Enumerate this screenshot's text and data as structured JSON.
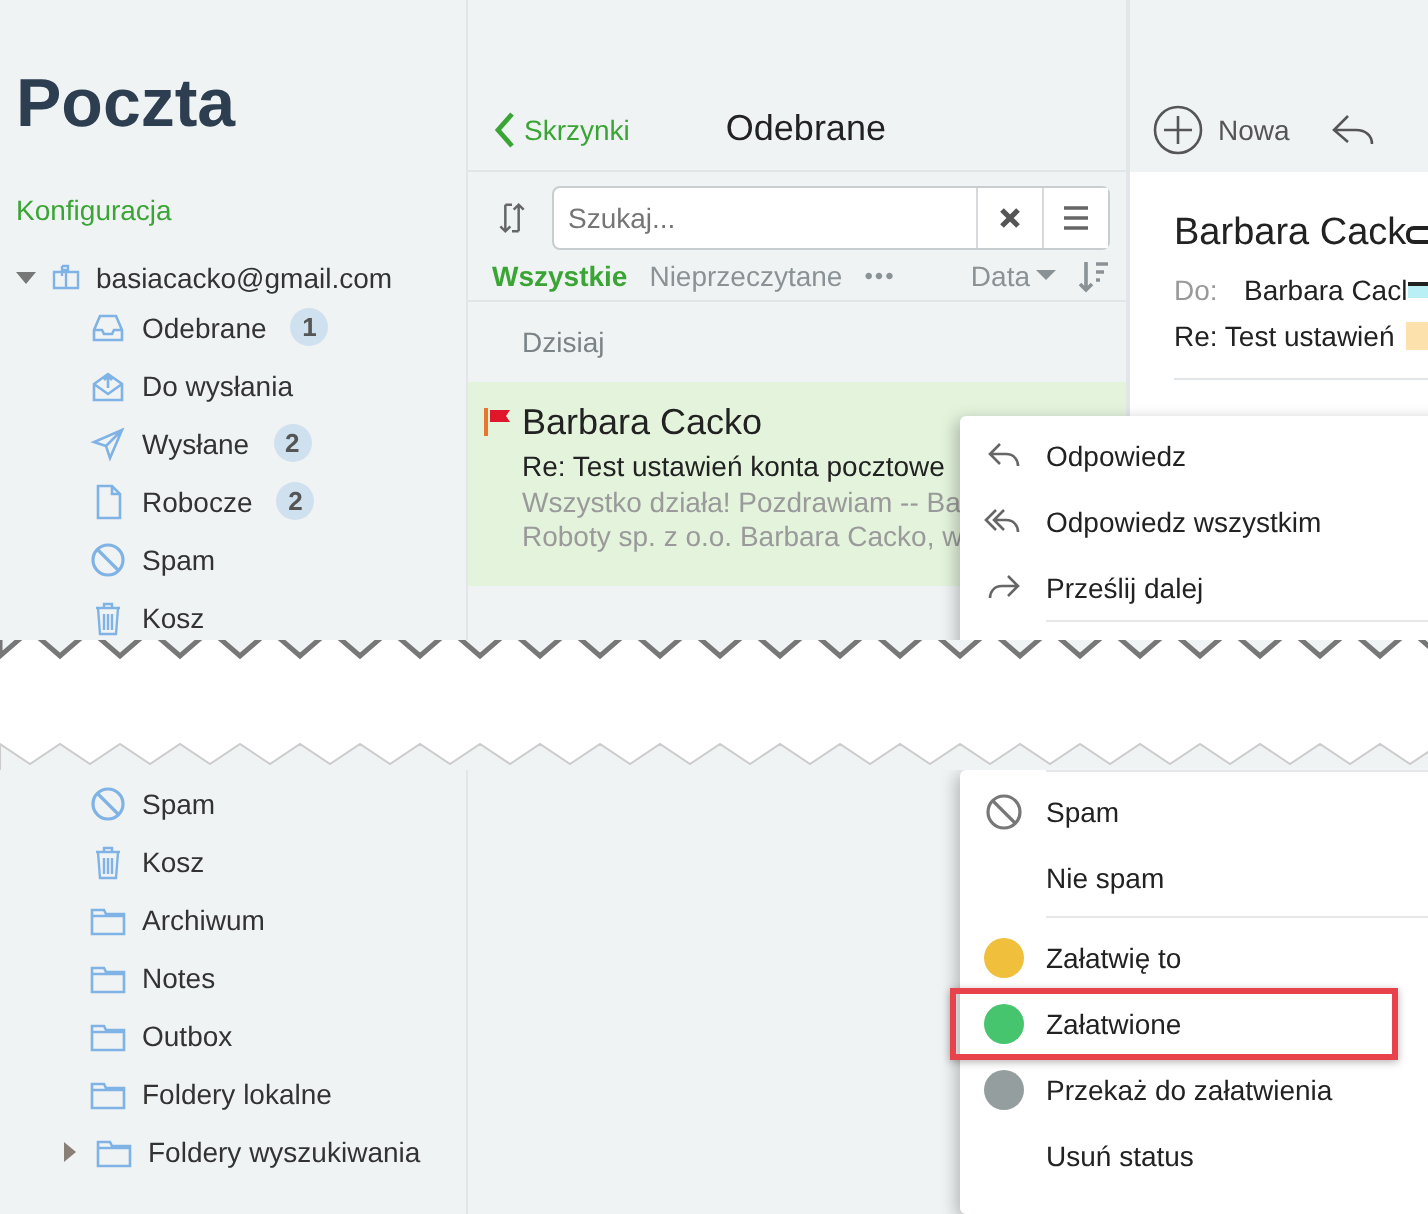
{
  "sidebar": {
    "title": "Poczta",
    "config_link": "Konfiguracja",
    "account": {
      "name": "basiacacko@gmail.com",
      "expanded": true
    },
    "folders_top": [
      {
        "name": "Odebrane",
        "kind": "inbox",
        "badge": "1"
      },
      {
        "name": "Do wysłania",
        "kind": "outbox"
      },
      {
        "name": "Wysłane",
        "kind": "sent",
        "badge": "2"
      },
      {
        "name": "Robocze",
        "kind": "draft",
        "badge": "2"
      },
      {
        "name": "Spam",
        "kind": "spam"
      },
      {
        "name": "Kosz",
        "kind": "trash"
      }
    ],
    "folders_bottom": [
      {
        "name": "Spam",
        "kind": "spam"
      },
      {
        "name": "Kosz",
        "kind": "trash"
      },
      {
        "name": "Archiwum",
        "kind": "folder"
      },
      {
        "name": "Notes",
        "kind": "folder"
      },
      {
        "name": "Outbox",
        "kind": "folder"
      },
      {
        "name": "Foldery lokalne",
        "kind": "folder"
      }
    ],
    "search_folders": {
      "name": "Foldery wyszukiwania",
      "kind": "folder",
      "expanded": false
    }
  },
  "message_list": {
    "back": "Skrzynki",
    "title": "Odebrane",
    "search": {
      "placeholder": "Szukaj..."
    },
    "filters": [
      {
        "label": "Wszystkie",
        "selected": true
      },
      {
        "label": "Nieprzeczytane",
        "selected": false
      }
    ],
    "more": "•••",
    "sort": "Data",
    "group": "Dzisiaj",
    "message": {
      "sender": "Barbara Cacko",
      "subject": "Re: Test ustawień konta pocztowe",
      "preview": [
        "Wszystko działa! Pozdrawiam -- Ba",
        "Roboty sp. z o.o. Barbara Cacko, w"
      ],
      "flagged": true,
      "selected": true
    }
  },
  "reader": {
    "new_button": "Nowa",
    "sender": "Barbara Cack",
    "to_label": "Do:",
    "to": "Barbara Cacl",
    "subject": "Re: Test ustawień"
  },
  "context_menu_top": [
    {
      "label": "Odpowiedz",
      "kind": "reply"
    },
    {
      "label": "Odpowiedz wszystkim",
      "kind": "replyall"
    },
    {
      "label": "Prześlij dalej",
      "kind": "forward"
    }
  ],
  "context_menu_bottom": [
    [
      {
        "label": "Spam",
        "kind": "spam",
        "highlighted": false
      },
      {
        "label": "Nie spam",
        "kind": "plain",
        "highlighted": false
      }
    ],
    [
      {
        "label": "Załatwię to",
        "kind": "status",
        "color": "#f0c03c",
        "highlighted": false
      },
      {
        "label": "Załatwione",
        "kind": "status",
        "color": "#46c46e",
        "highlighted": true
      },
      {
        "label": "Przekaż do załatwienia",
        "kind": "status",
        "color": "#959e9f",
        "highlighted": false
      },
      {
        "label": "Usuń status",
        "kind": "plain",
        "highlighted": false
      }
    ]
  ]
}
